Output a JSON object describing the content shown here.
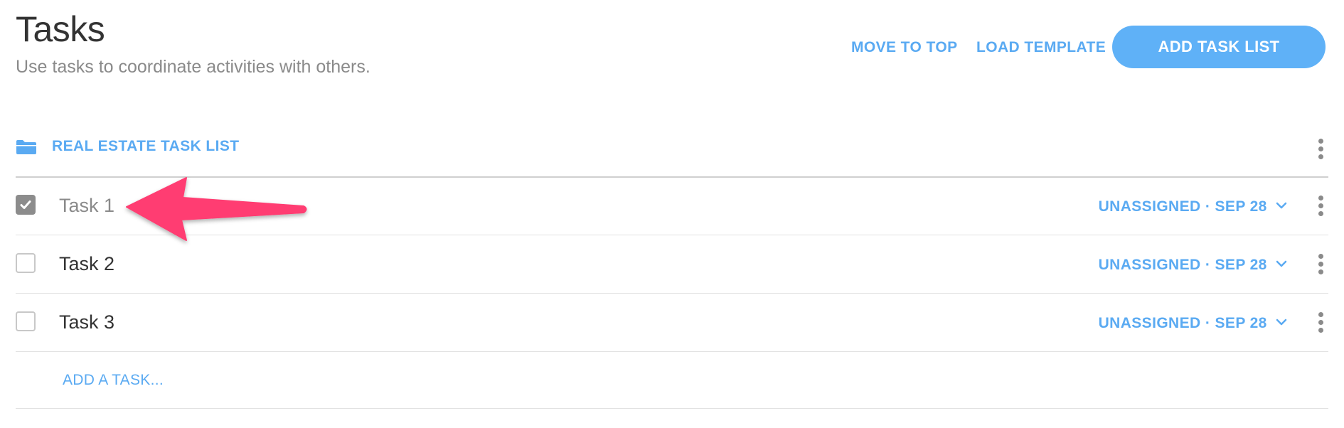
{
  "header": {
    "title": "Tasks",
    "subtitle": "Use tasks to coordinate activities with others.",
    "move_to_top_label": "MOVE TO TOP",
    "load_template_label": "LOAD TEMPLATE",
    "add_task_list_label": "ADD TASK LIST"
  },
  "task_list": {
    "title": "REAL ESTATE TASK LIST",
    "icon": "folder-icon",
    "menu_icon": "kebab-menu-icon",
    "tasks": [
      {
        "name": "Task 1",
        "completed": true,
        "assignee": "UNASSIGNED",
        "separator": "·",
        "due": "SEP 28"
      },
      {
        "name": "Task 2",
        "completed": false,
        "assignee": "UNASSIGNED",
        "separator": "·",
        "due": "SEP 28"
      },
      {
        "name": "Task 3",
        "completed": false,
        "assignee": "UNASSIGNED",
        "separator": "·",
        "due": "SEP 28"
      }
    ],
    "add_task_label": "ADD A TASK..."
  },
  "annotation": {
    "icon": "arrow-annotation-icon",
    "color": "#ff3d72"
  },
  "colors": {
    "accent": "#5aaaf2",
    "button_bg": "#5fb1f7",
    "text_dark": "#333333",
    "text_muted": "#8a8a8a",
    "checked_bg": "#8c8c8c"
  }
}
